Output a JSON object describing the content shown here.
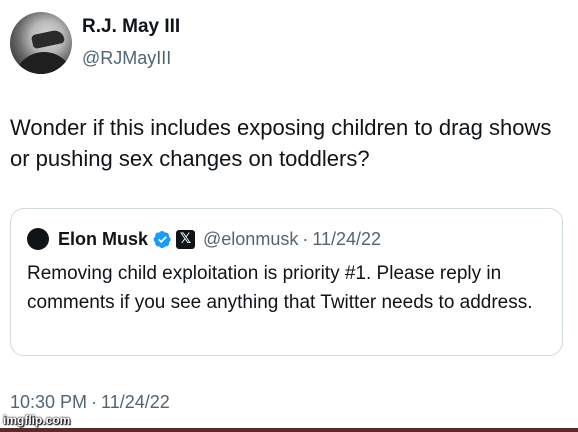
{
  "tweet": {
    "author": {
      "display_name": "R.J. May III",
      "handle": "@RJMayIII"
    },
    "text": "Wonder if this includes exposing children to drag shows or pushing sex changes on toddlers?",
    "timestamp": {
      "time": "10:30 PM",
      "separator": "·",
      "date": "11/24/22"
    }
  },
  "quoted_tweet": {
    "author": {
      "display_name": "Elon Musk",
      "handle": "@elonmusk",
      "verified_icon": "verified-badge-icon",
      "affiliation_icon": "x-logo-icon",
      "x_badge_glyph": "𝕏"
    },
    "separator": "·",
    "date": "11/24/22",
    "text": "Removing child exploitation is priority #1. Please reply in comments if you see anything that Twitter needs to address."
  },
  "watermark": "imgflip.com",
  "colors": {
    "text_primary": "#0f1419",
    "text_secondary": "#536471",
    "verified_blue": "#1d9bf0",
    "card_border": "#cfd9de"
  }
}
